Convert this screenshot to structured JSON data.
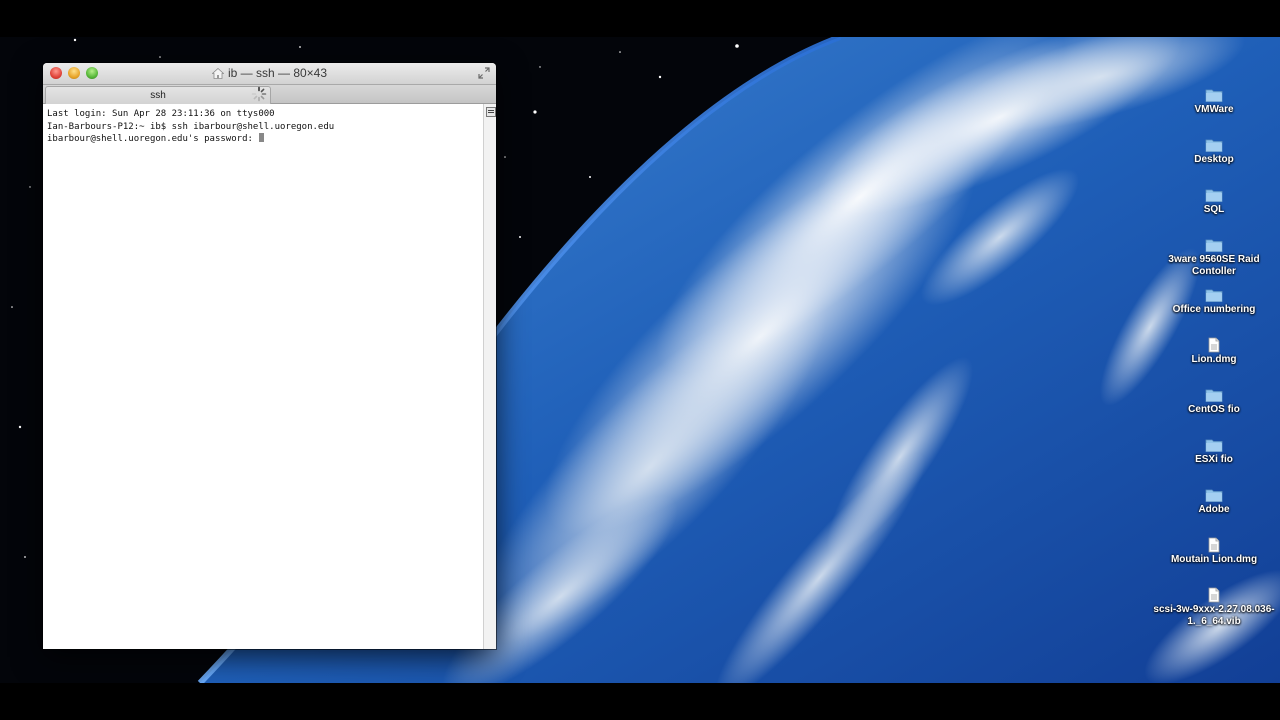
{
  "window": {
    "title": "ib — ssh — 80×43",
    "tab_label": "ssh"
  },
  "terminal": {
    "lines": [
      "Last login: Sun Apr 28 23:11:36 on ttys000",
      "Ian-Barbours-P12:~ ib$ ssh ibarbour@shell.uoregon.edu",
      "ibarbour@shell.uoregon.edu's password: "
    ]
  },
  "desktop": {
    "icons": [
      {
        "label": "VMWare",
        "type": "folder-icon"
      },
      {
        "label": "Desktop",
        "type": "folder-icon"
      },
      {
        "label": "SQL",
        "type": "folder-icon"
      },
      {
        "label": "3ware 9560SE Raid Contoller",
        "type": "folder-icon"
      },
      {
        "label": "Office numbering",
        "type": "folder-icon"
      },
      {
        "label": "Lion.dmg",
        "type": "file-icon"
      },
      {
        "label": "CentOS fio",
        "type": "folder-icon"
      },
      {
        "label": "ESXi fio",
        "type": "folder-icon"
      },
      {
        "label": "Adobe",
        "type": "folder-icon"
      },
      {
        "label": "Moutain Lion.dmg",
        "type": "file-icon"
      },
      {
        "label": "scsi-3w-9xxx-2.27.08.036-1._6_64.vib",
        "type": "file-icon"
      }
    ]
  },
  "colors": {
    "close": "#e0443a",
    "minimize": "#e8a52a",
    "zoom": "#58b83a",
    "folder": "#8fc3ea"
  }
}
